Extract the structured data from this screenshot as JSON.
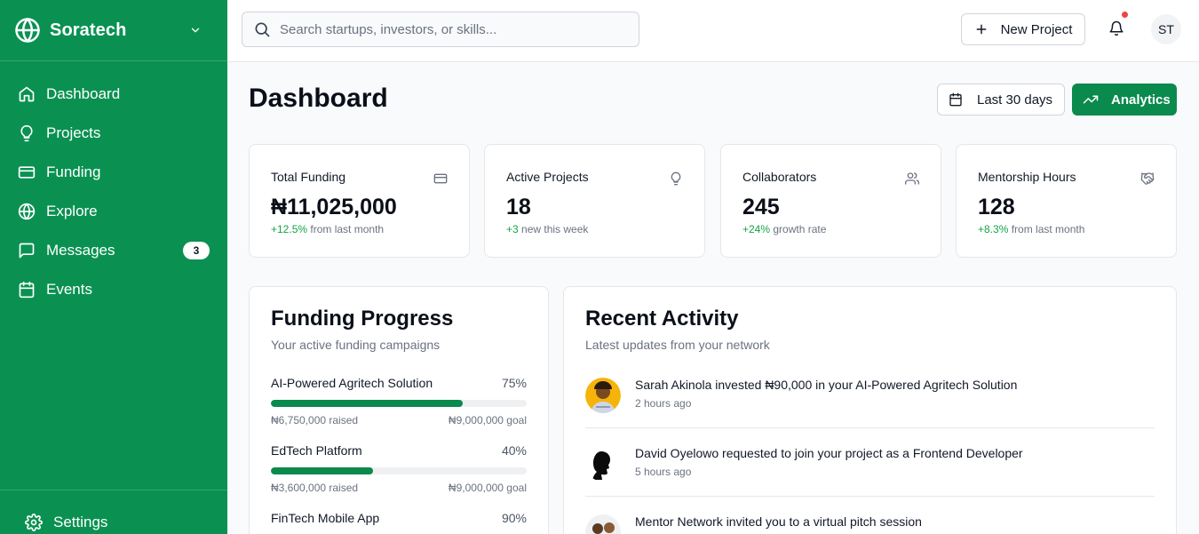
{
  "brand": {
    "name": "Soratech"
  },
  "sidebar": {
    "items": [
      {
        "label": "Dashboard",
        "icon": "home-icon"
      },
      {
        "label": "Projects",
        "icon": "lightbulb-icon"
      },
      {
        "label": "Funding",
        "icon": "credit-card-icon"
      },
      {
        "label": "Explore",
        "icon": "globe-icon"
      },
      {
        "label": "Messages",
        "icon": "message-icon",
        "badge": "3"
      },
      {
        "label": "Events",
        "icon": "calendar-icon"
      }
    ],
    "settings_label": "Settings"
  },
  "topbar": {
    "search_placeholder": "Search startups, investors, or skills...",
    "new_project_label": "New Project",
    "avatar_initials": "ST"
  },
  "header": {
    "title": "Dashboard",
    "range_label": "Last 30 days",
    "analytics_label": "Analytics"
  },
  "stats": [
    {
      "label": "Total Funding",
      "value": "₦11,025,000",
      "delta": "+12.5%",
      "delta_text": " from last month",
      "icon": "credit-card-icon"
    },
    {
      "label": "Active Projects",
      "value": "18",
      "delta": "+3",
      "delta_text": " new this week",
      "icon": "lightbulb-icon"
    },
    {
      "label": "Collaborators",
      "value": "245",
      "delta": "+24%",
      "delta_text": " growth rate",
      "icon": "users-icon"
    },
    {
      "label": "Mentorship Hours",
      "value": "128",
      "delta": "+8.3%",
      "delta_text": " from last month",
      "icon": "handshake-icon"
    }
  ],
  "funding": {
    "title": "Funding Progress",
    "subtitle": "Your active funding campaigns",
    "items": [
      {
        "name": "AI-Powered Agritech Solution",
        "percent": "75%",
        "progress": 0.75,
        "raised": "₦6,750,000 raised",
        "goal": "₦9,000,000 goal"
      },
      {
        "name": "EdTech Platform",
        "percent": "40%",
        "progress": 0.4,
        "raised": "₦3,600,000 raised",
        "goal": "₦9,000,000 goal"
      },
      {
        "name": "FinTech Mobile App",
        "percent": "90%",
        "progress": 0.9,
        "raised": "",
        "goal": ""
      }
    ]
  },
  "activity": {
    "title": "Recent Activity",
    "subtitle": "Latest updates from your network",
    "items": [
      {
        "text": "Sarah Akinola invested ₦90,000 in your AI-Powered Agritech Solution",
        "time": "2 hours ago"
      },
      {
        "text": "David Oyelowo requested to join your project as a Frontend Developer",
        "time": "5 hours ago"
      },
      {
        "text": "Mentor Network invited you to a virtual pitch session",
        "time": ""
      }
    ]
  },
  "colors": {
    "brand": "#0a9152",
    "accent": "#0a8a4d",
    "positive": "#16a34a",
    "notification": "#ef4444"
  }
}
